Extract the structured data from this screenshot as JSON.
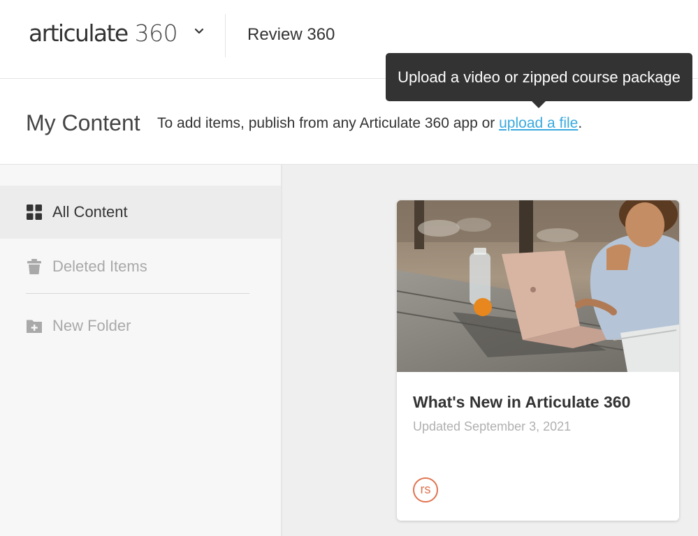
{
  "topbar": {
    "brand_word": "articulate",
    "brand_number": "360",
    "app_name": "Review 360"
  },
  "header": {
    "title": "My Content",
    "hint_text": "To add items, publish from any Articulate 360 app or ",
    "hint_link": "upload a file",
    "hint_end": "."
  },
  "tooltip": {
    "text": "Upload a video or zipped course package"
  },
  "sidebar": {
    "items": [
      {
        "label": "All Content",
        "icon": "grid-icon",
        "active": true
      },
      {
        "label": "Deleted Items",
        "icon": "trash-icon",
        "active": false
      },
      {
        "label": "New Folder",
        "icon": "add-folder-icon",
        "active": false
      }
    ]
  },
  "content": {
    "items": [
      {
        "title": "What's New in Articulate 360",
        "updated": "Updated September 3, 2021",
        "avatar_initials": "rs"
      }
    ]
  },
  "colors": {
    "link": "#3aa9df",
    "tooltip_bg": "#333333",
    "avatar": "#e0734f",
    "sidebar_bg": "#f7f7f7",
    "main_bg": "#efefef"
  }
}
